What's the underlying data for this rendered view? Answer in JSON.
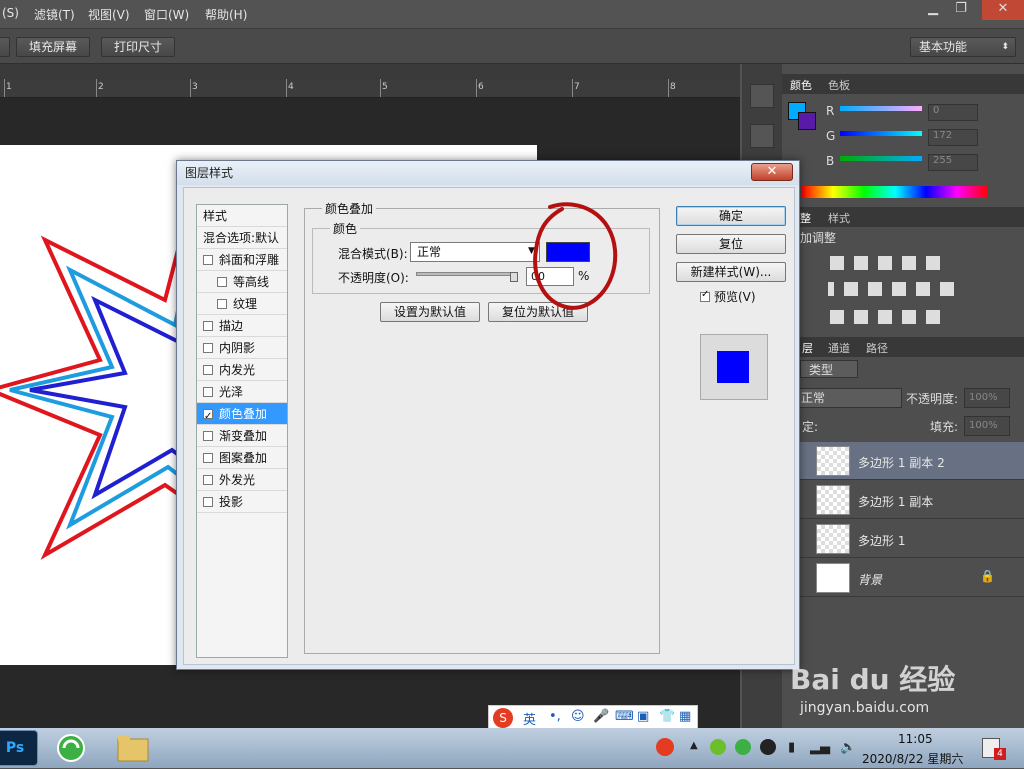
{
  "menubar": {
    "items": [
      "(S)",
      "滤镜(T)",
      "视图(V)",
      "窗口(W)",
      "帮助(H)"
    ],
    "minimize": "▁",
    "restore": "❐",
    "close": "✕"
  },
  "options": {
    "fill_screen": "填充屏幕",
    "print_size": "打印尺寸",
    "workspace": "基本功能"
  },
  "ruler": {
    "ticks": [
      "1",
      "2",
      "3",
      "4",
      "5",
      "6",
      "7",
      "8"
    ]
  },
  "color_panel": {
    "tabs": [
      "颜色",
      "色板"
    ],
    "channels": [
      {
        "label": "R",
        "value": "0"
      },
      {
        "label": "G",
        "value": "172"
      },
      {
        "label": "B",
        "value": "255"
      }
    ],
    "foreground": "#00acff",
    "background": "#5a1aa8"
  },
  "adjust_panel": {
    "tabs": [
      "整",
      "样式"
    ],
    "title": "加调整"
  },
  "layers_panel": {
    "tabs": [
      "层",
      "通道",
      "路径"
    ],
    "filter_label": "类型",
    "blend": "正常",
    "opacity_label": "不透明度:",
    "opacity_value": "100%",
    "lock_label": "定:",
    "fill_label": "填充:",
    "fill_value": "100%",
    "layers": [
      {
        "name": "多边形 1 副本 2",
        "selected": true
      },
      {
        "name": "多边形 1 副本",
        "selected": false
      },
      {
        "name": "多边形 1",
        "selected": false
      },
      {
        "name": "背景",
        "selected": false
      }
    ]
  },
  "dialog": {
    "title": "图层样式",
    "close": "✕",
    "styles_header": "样式",
    "blend_options": "混合选项:默认",
    "style_items": [
      {
        "label": "斜面和浮雕",
        "checked": false,
        "indent": false
      },
      {
        "label": "等高线",
        "checked": false,
        "indent": true
      },
      {
        "label": "纹理",
        "checked": false,
        "indent": true
      },
      {
        "label": "描边",
        "checked": false,
        "indent": false
      },
      {
        "label": "内阴影",
        "checked": false,
        "indent": false
      },
      {
        "label": "内发光",
        "checked": false,
        "indent": false
      },
      {
        "label": "光泽",
        "checked": false,
        "indent": false
      },
      {
        "label": "颜色叠加",
        "checked": true,
        "indent": false,
        "selected": true
      },
      {
        "label": "渐变叠加",
        "checked": false,
        "indent": false
      },
      {
        "label": "图案叠加",
        "checked": false,
        "indent": false
      },
      {
        "label": "外发光",
        "checked": false,
        "indent": false
      },
      {
        "label": "投影",
        "checked": false,
        "indent": false
      }
    ],
    "section_title": "颜色叠加",
    "sub_title": "颜色",
    "blend_mode_label": "混合模式(B):",
    "blend_mode_value": "正常",
    "overlay_color": "#0000ff",
    "opacity_label": "不透明度(O):",
    "opacity_value": "00",
    "percent": "%",
    "set_default": "设置为默认值",
    "reset_default": "复位为默认值",
    "ok": "确定",
    "reset": "复位",
    "new_style": "新建样式(W)...",
    "preview_label": "预览(V)",
    "preview_checked": true
  },
  "ime": {
    "lang": "英"
  },
  "taskbar": {
    "time": "11:05",
    "date": "2020/8/22 星期六",
    "badge": "4",
    "ps_label": "Ps"
  },
  "watermark": {
    "logo": "Bai du 经验",
    "url": "jingyan.baidu.com"
  }
}
